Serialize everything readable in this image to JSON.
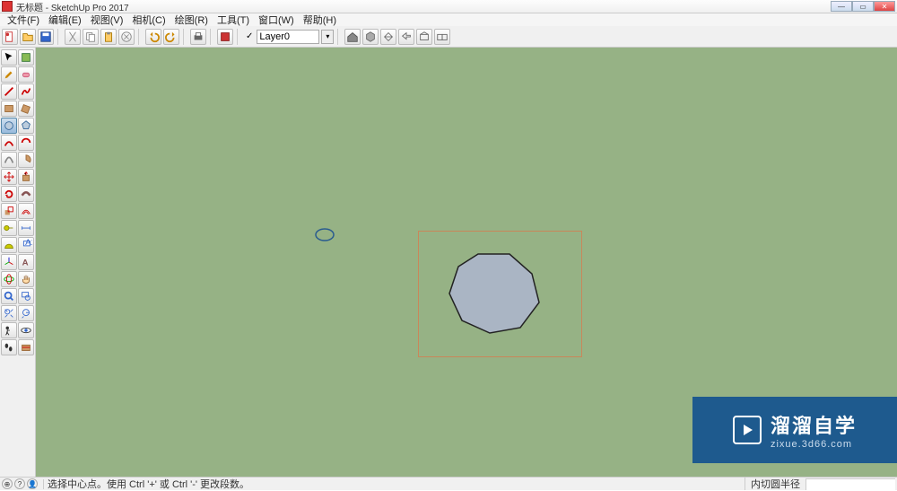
{
  "window": {
    "title": "无标题 - SketchUp Pro 2017",
    "controls": {
      "min": "—",
      "max": "▭",
      "close": "✕"
    }
  },
  "menu": {
    "file": "文件(F)",
    "edit": "编辑(E)",
    "view": "视图(V)",
    "camera": "相机(C)",
    "draw": "绘图(R)",
    "tools": "工具(T)",
    "window": "窗口(W)",
    "help": "帮助(H)"
  },
  "toolbar": {
    "layer_check": "✓",
    "layer_value": "Layer0",
    "layer_dd": "▾"
  },
  "status": {
    "hint": "选择中心点。使用 Ctrl '+' 或 Ctrl '-' 更改段数。",
    "label": "内切圆半径",
    "value": ""
  },
  "watermark": {
    "cn": "溜溜自学",
    "en": "zixue.3d66.com"
  },
  "icons": {
    "select": "select",
    "eraser": "eraser",
    "line": "line",
    "arc": "arc",
    "rect": "rect",
    "circle": "circle",
    "polygon": "polygon",
    "freehand": "freehand"
  }
}
